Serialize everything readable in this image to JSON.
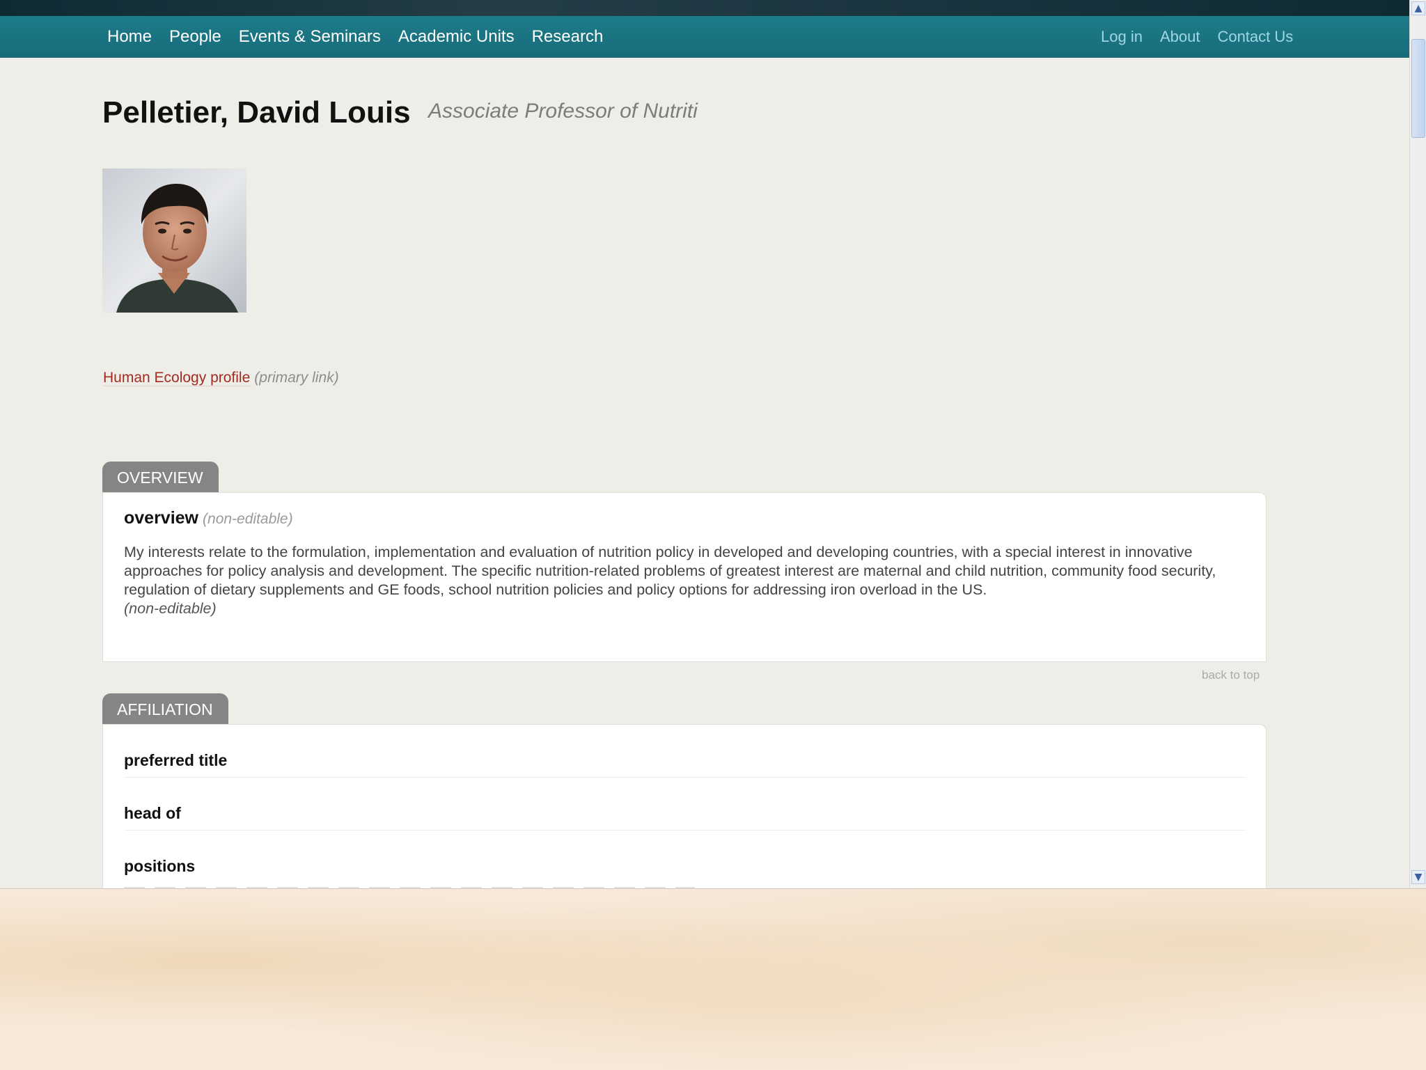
{
  "nav": {
    "left": [
      "Home",
      "People",
      "Events & Seminars",
      "Academic Units",
      "Research"
    ],
    "right": [
      "Log in",
      "About",
      "Contact Us"
    ]
  },
  "profile": {
    "name": "Pelletier, David Louis",
    "title": "Associate Professor of Nutriti",
    "primary_link": {
      "label": "Human Ecology profile",
      "note": "(primary link)"
    }
  },
  "overview": {
    "tab": "OVERVIEW",
    "label": "overview",
    "label_note": "(non-editable)",
    "text": "My interests relate to the formulation, implementation and evaluation of nutrition policy in developed and developing countries, with a special interest in innovative approaches for policy analysis and development. The specific nutrition-related problems of greatest interest are maternal and child nutrition, community food security, regulation of dietary supplements and GE foods, school nutrition policies and policy options for addressing iron overload in the US.",
    "text_note": "(non-editable)",
    "back_to_top": "back to top"
  },
  "affiliation": {
    "tab": "AFFILIATION",
    "rows": [
      "preferred title",
      "head of",
      "positions"
    ]
  },
  "colors": {
    "navbar": "#1b7482",
    "tab": "#858585",
    "link": "#a22b22"
  },
  "icons": {
    "scroll_up": "chevron-up-icon",
    "scroll_down": "chevron-down-icon"
  }
}
